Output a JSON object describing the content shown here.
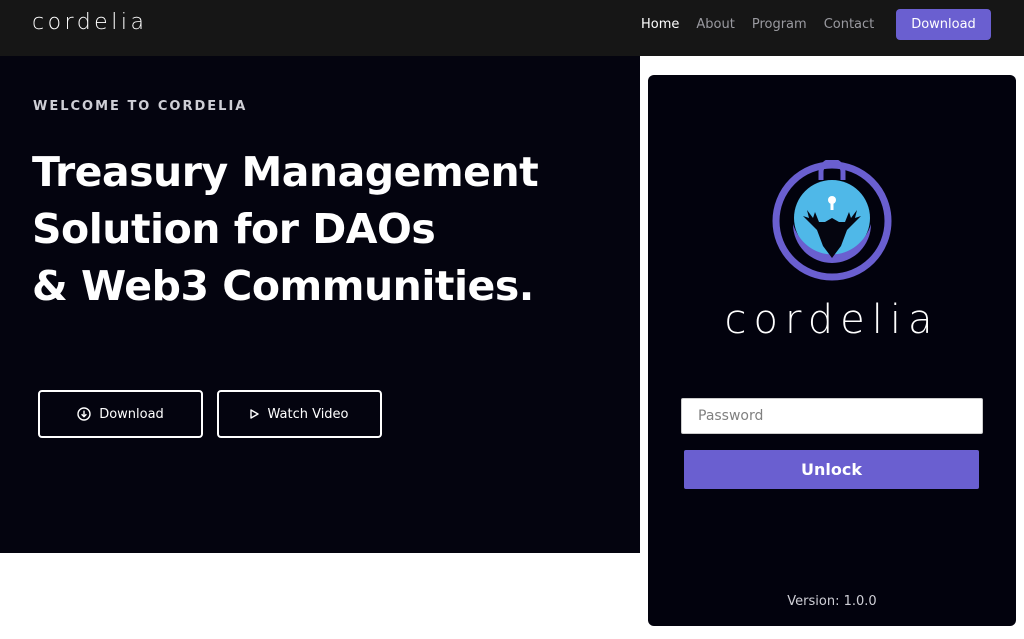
{
  "navbar": {
    "brand": "cordelia",
    "links": [
      "Home",
      "About",
      "Program",
      "Contact"
    ],
    "download_label": "Download"
  },
  "hero": {
    "eyebrow": "WELCOME TO CORDELIA",
    "headline_lines": [
      "Treasury Management",
      "Solution for DAOs",
      "& Web3 Communities."
    ],
    "download_label": "Download",
    "video_label": "Watch Video"
  },
  "popup": {
    "brand": "cordelia",
    "password_placeholder": "Password",
    "unlock_label": "Unlock",
    "version": "Version: 1.0.0"
  },
  "colors": {
    "accent": "#6a5fd0",
    "nav_bg": "#161616",
    "hero_bg": "#04040f",
    "popup_bg": "#02020d",
    "logo_blue": "#4fb8e8"
  },
  "icons": [
    "download-circle-icon",
    "play-icon",
    "lock-deer-logo"
  ]
}
